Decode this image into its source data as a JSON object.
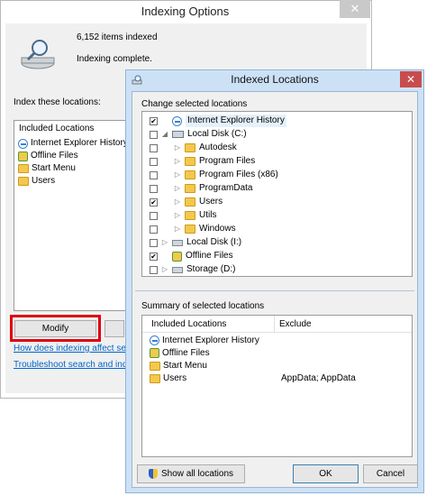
{
  "indexing_options": {
    "title": "Indexing Options",
    "close_glyph": "✕",
    "items_indexed": "6,152 items indexed",
    "status": "Indexing complete.",
    "index_these_label": "Index these locations:",
    "list_header": "Included Locations",
    "locations": [
      "Internet Explorer History",
      "Offline Files",
      "Start Menu",
      "Users"
    ],
    "modify_button": "Modify",
    "link_how": "How does indexing affect searc",
    "link_troubleshoot": "Troubleshoot search and indexi"
  },
  "indexed_locations": {
    "title": "Indexed Locations",
    "close_glyph": "✕",
    "change_group_label": "Change selected locations",
    "tree": [
      {
        "label": "Internet Explorer History",
        "checked": "✔",
        "expander": ""
      },
      {
        "label": "Local Disk (C:)",
        "checked": "",
        "expander": "◢"
      },
      {
        "label": "Autodesk",
        "checked": "",
        "expander": "▷"
      },
      {
        "label": "Program Files",
        "checked": "",
        "expander": "▷"
      },
      {
        "label": "Program Files (x86)",
        "checked": "",
        "expander": "▷"
      },
      {
        "label": "ProgramData",
        "checked": "",
        "expander": "▷"
      },
      {
        "label": "Users",
        "checked": "✔",
        "expander": "▷"
      },
      {
        "label": "Utils",
        "checked": "",
        "expander": "▷"
      },
      {
        "label": "Windows",
        "checked": "",
        "expander": "▷"
      },
      {
        "label": "Local Disk (I:)",
        "checked": "",
        "expander": "▷"
      },
      {
        "label": "Offline Files",
        "checked": "✔",
        "expander": ""
      },
      {
        "label": "Storage (D:)",
        "checked": "",
        "expander": "▷"
      }
    ],
    "summary_group_label": "Summary of selected locations",
    "summary_columns": [
      "Included Locations",
      "Exclude"
    ],
    "summary_rows": [
      {
        "location": "Internet Explorer History",
        "exclude": ""
      },
      {
        "location": "Offline Files",
        "exclude": ""
      },
      {
        "location": "Start Menu",
        "exclude": ""
      },
      {
        "location": "Users",
        "exclude": "AppData; AppData"
      }
    ],
    "show_all_button": "Show all locations",
    "ok_button": "OK",
    "cancel_button": "Cancel"
  }
}
